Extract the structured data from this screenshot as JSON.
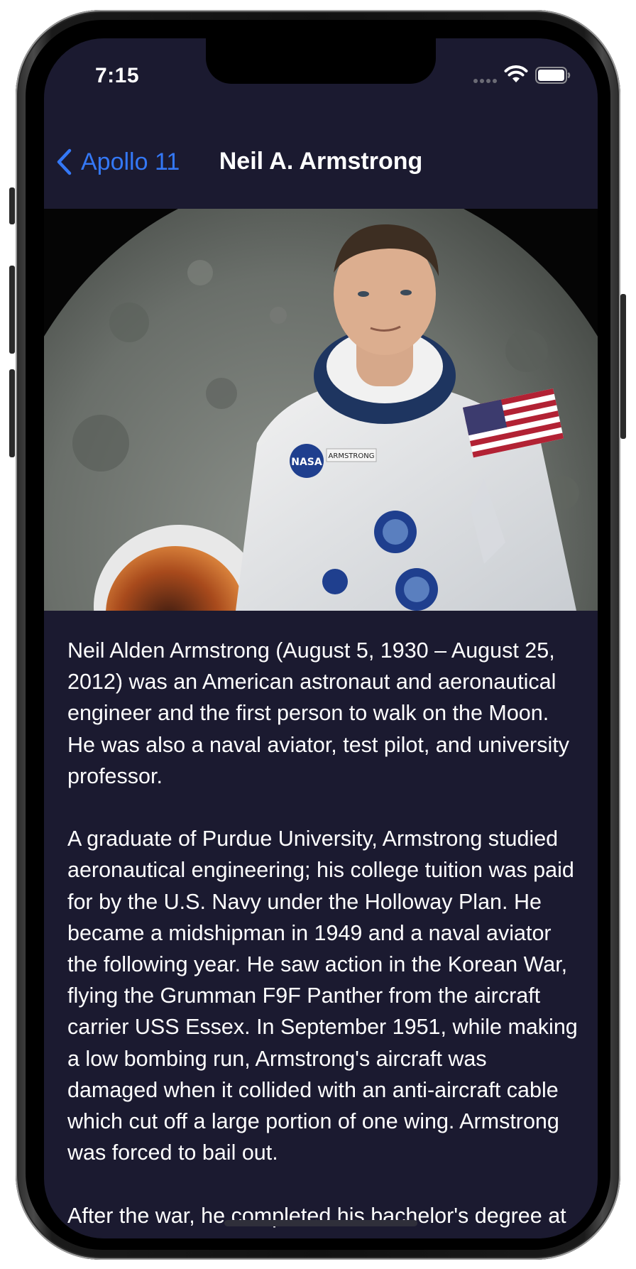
{
  "status_bar": {
    "time": "7:15"
  },
  "nav": {
    "back_label": "Apollo 11",
    "title": "Neil A. Armstrong"
  },
  "portrait": {
    "name_tag": "ARMSTRONG",
    "logo_text": "NASA"
  },
  "bio": {
    "paragraphs": [
      "Neil Alden Armstrong (August 5, 1930 – August 25, 2012) was an American astronaut and aeronautical engineer and the first person to walk on the Moon. He was also a naval aviator, test pilot, and university professor.",
      "A graduate of Purdue University, Armstrong studied aeronautical engineering; his college tuition was paid for by the U.S. Navy under the Holloway Plan. He became a midshipman in 1949 and a naval aviator the following year. He saw action in the Korean War, flying the Grumman F9F Panther from the aircraft carrier USS Essex. In September 1951, while making a low bombing run, Armstrong's aircraft was damaged when it collided with an anti-aircraft cable which cut off a large portion of one wing. Armstrong was forced to bail out.",
      "After the war, he completed his bachelor's degree at Purdue and became a test pilot at"
    ]
  },
  "colors": {
    "background": "#1b1a30",
    "accent": "#3478f6",
    "text": "#ffffff"
  }
}
